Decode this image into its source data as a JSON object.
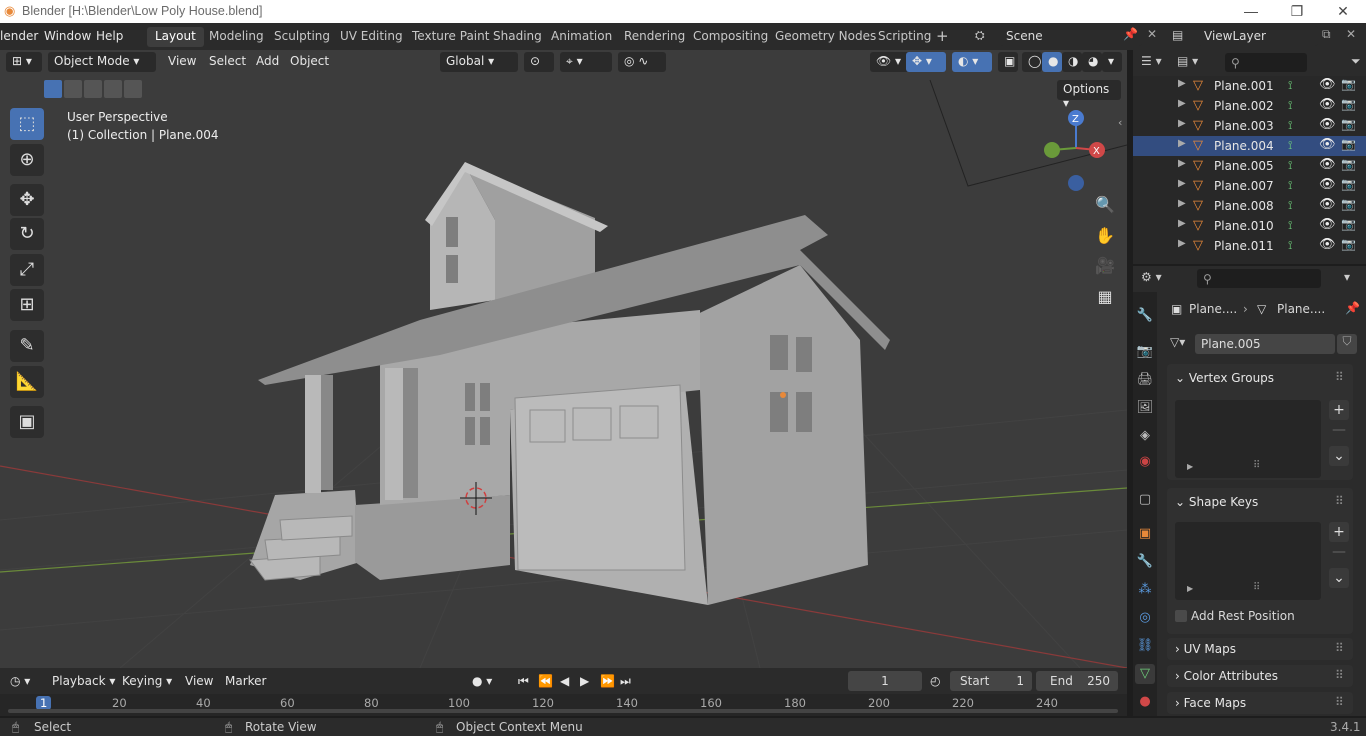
{
  "window": {
    "title": "Blender [H:\\Blender\\Low Poly House.blend]"
  },
  "topbar": {
    "menus": [
      "lender",
      "Window",
      "Help"
    ],
    "workspaces": [
      "Layout",
      "Modeling",
      "Sculpting",
      "UV Editing",
      "Texture Paint",
      "Shading",
      "Animation",
      "Rendering",
      "Compositing",
      "Geometry Nodes",
      "Scripting"
    ],
    "active_workspace": "Layout",
    "add_tab": "+",
    "scene": "Scene",
    "viewlayer": "ViewLayer"
  },
  "viewport": {
    "mode": "Object Mode",
    "menus": [
      "View",
      "Select",
      "Add",
      "Object"
    ],
    "transform_orientation": "Global",
    "options_label": "Options",
    "perspective_label": "User Perspective",
    "collection_label": "(1) Collection | Plane.004",
    "gizmo_axes": [
      "Z",
      "X"
    ]
  },
  "outliner": {
    "items": [
      {
        "name": "Plane.001",
        "selected": false
      },
      {
        "name": "Plane.002",
        "selected": false
      },
      {
        "name": "Plane.003",
        "selected": false
      },
      {
        "name": "Plane.004",
        "selected": true
      },
      {
        "name": "Plane.005",
        "selected": false
      },
      {
        "name": "Plane.007",
        "selected": false
      },
      {
        "name": "Plane.008",
        "selected": false
      },
      {
        "name": "Plane.010",
        "selected": false
      },
      {
        "name": "Plane.011",
        "selected": false
      }
    ]
  },
  "properties": {
    "breadcrumb_object": "Plane....",
    "breadcrumb_data": "Plane....",
    "data_name": "Plane.005",
    "panels": {
      "vertex_groups": "Vertex Groups",
      "shape_keys": "Shape Keys",
      "add_rest_position": "Add Rest Position",
      "uv_maps": "UV Maps",
      "color_attributes": "Color Attributes",
      "face_maps": "Face Maps"
    }
  },
  "timeline": {
    "menus": [
      "Playback",
      "Keying",
      "View",
      "Marker"
    ],
    "current_frame": "1",
    "start_label": "Start",
    "start_value": "1",
    "end_label": "End",
    "end_value": "250",
    "ruler_numbers": [
      "1",
      "20",
      "40",
      "60",
      "80",
      "100",
      "120",
      "140",
      "160",
      "180",
      "200",
      "220",
      "240"
    ]
  },
  "statusbar": {
    "select": "Select",
    "rotate": "Rotate View",
    "context": "Object Context Menu",
    "version": "3.4.1"
  },
  "colors": {
    "accent": "#4772b3",
    "orange": "#e8893a",
    "viewport_bg": "#3c3c3c"
  }
}
